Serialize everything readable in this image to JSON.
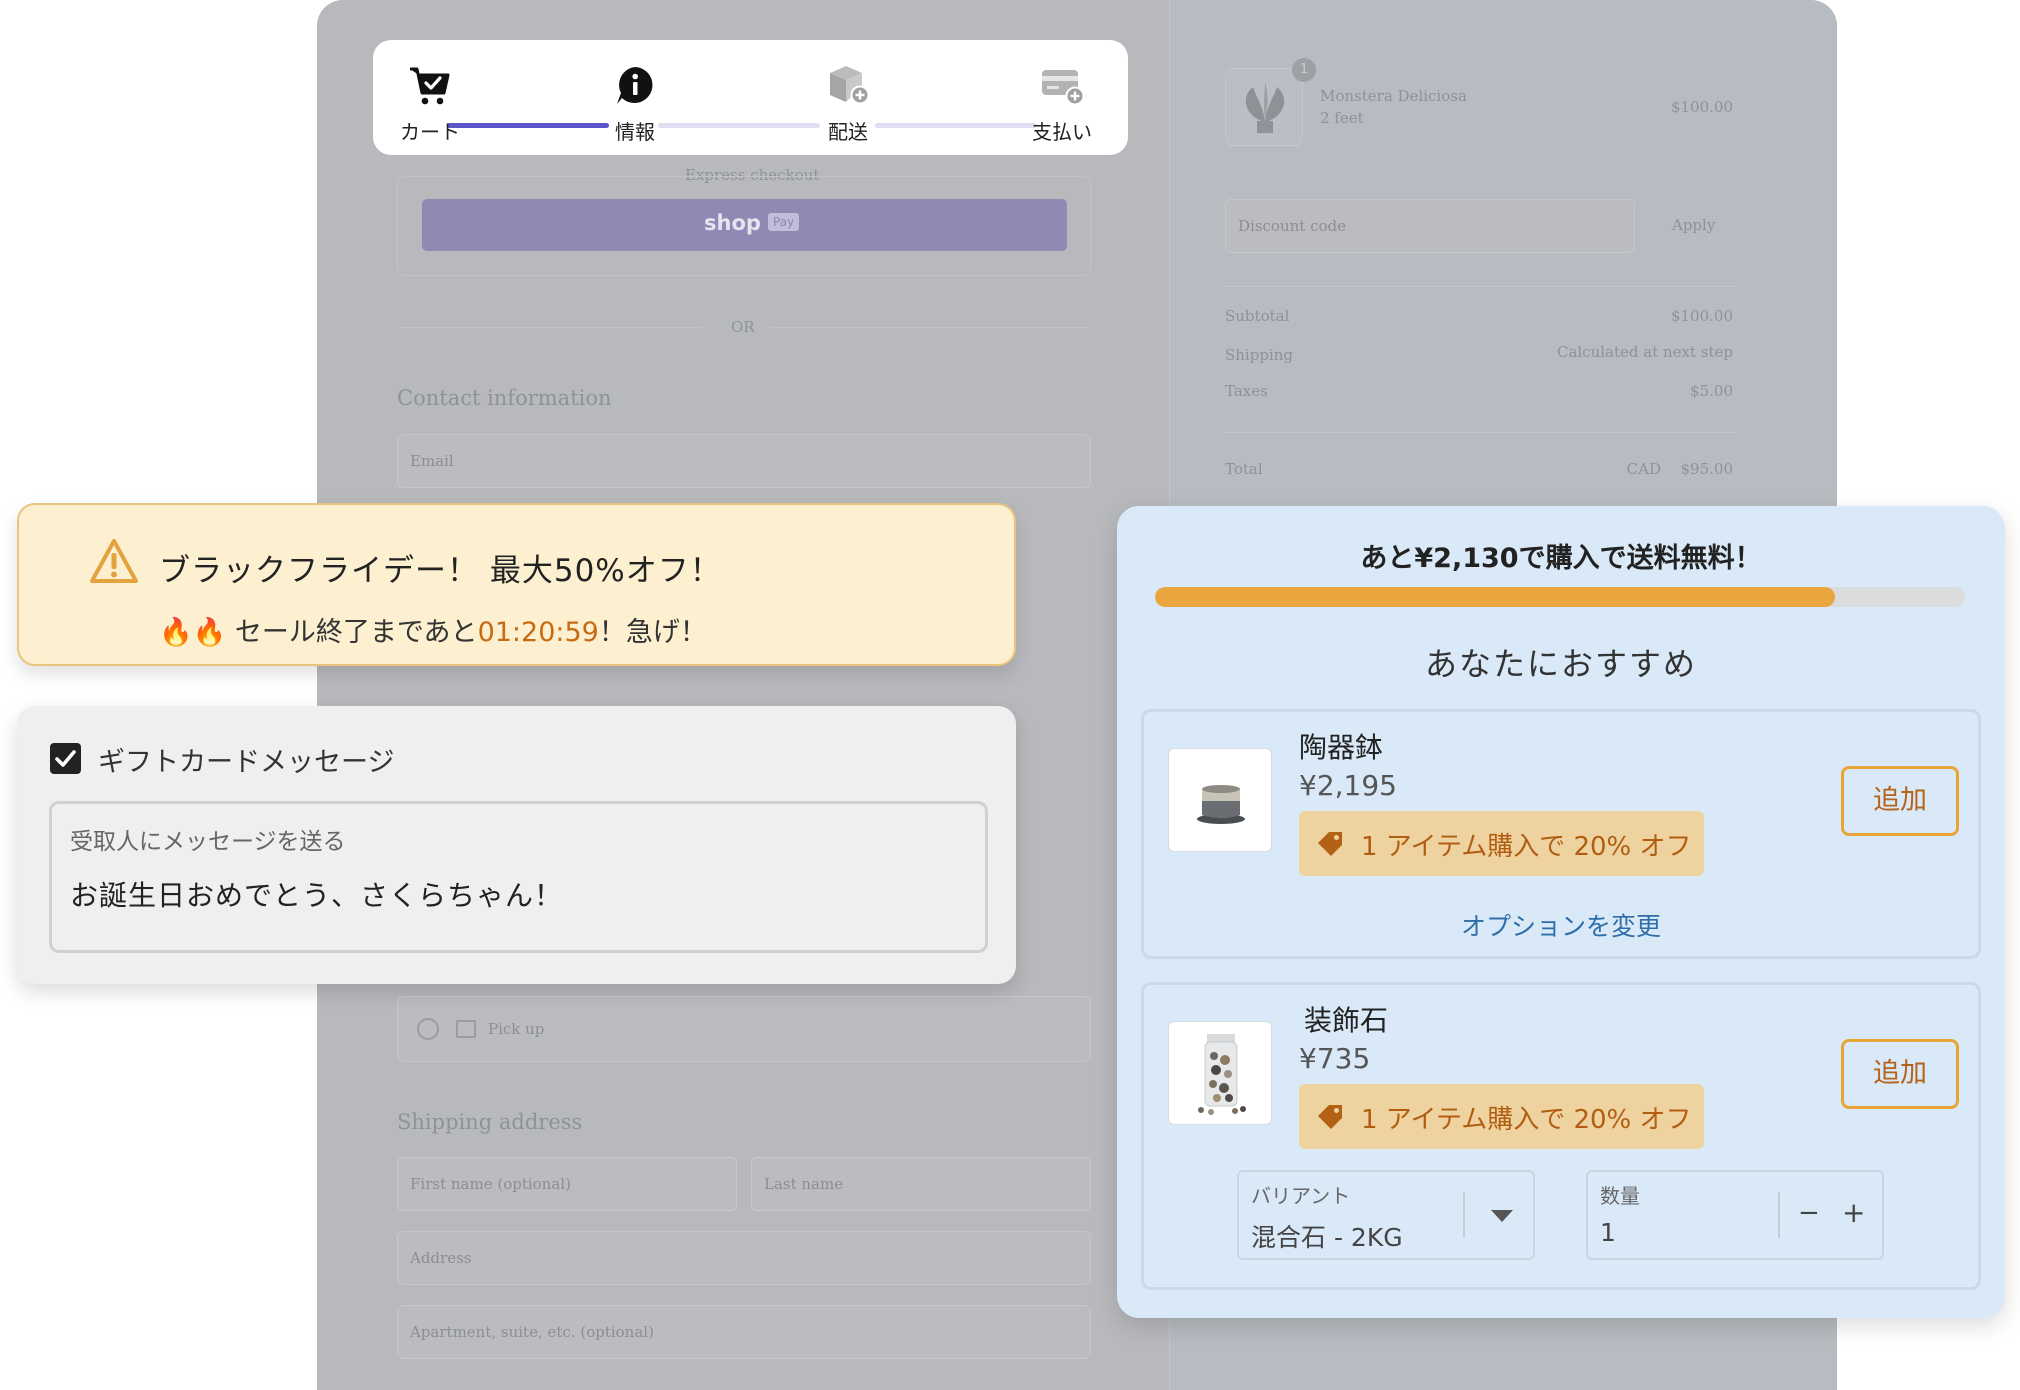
{
  "checkout": {
    "express_checkout": "Express checkout",
    "shop_pay": "shop",
    "shop_pay_badge": "Pay",
    "or": "OR",
    "contact_title": "Contact information",
    "email_placeholder": "Email",
    "pickup_label": "Pick up",
    "shipping_title": "Shipping address",
    "first_name_placeholder": "First name (optional)",
    "last_name_placeholder": "Last name",
    "address_placeholder": "Address",
    "apartment_placeholder": "Apartment, suite, etc. (optional)"
  },
  "summary": {
    "item_name": "Monstera Deliciosa",
    "item_variant": "2 feet",
    "item_qty": "1",
    "item_price": "$100.00",
    "discount_placeholder": "Discount code",
    "apply_label": "Apply",
    "subtotal_label": "Subtotal",
    "subtotal_value": "$100.00",
    "shipping_label": "Shipping",
    "shipping_value": "Calculated at next step",
    "taxes_label": "Taxes",
    "taxes_value": "$5.00",
    "total_label": "Total",
    "total_currency": "CAD",
    "total_value": "$95.00"
  },
  "stepper": {
    "steps": [
      {
        "label": "カート",
        "icon": "cart-icon"
      },
      {
        "label": "情報",
        "icon": "info-icon"
      },
      {
        "label": "配送",
        "icon": "box-icon"
      },
      {
        "label": "支払い",
        "icon": "card-icon"
      }
    ],
    "colors": {
      "active": "#5a55c9",
      "inactive": "#e1dff3"
    }
  },
  "promo": {
    "icon": "warning-icon",
    "title": "ブラックフライデー！ 最大50%オフ！",
    "sub_prefix": "🔥🔥 セール終了まであと",
    "timer": "01:20:59",
    "sub_suffix": "！急げ！"
  },
  "gift": {
    "checked": true,
    "title": "ギフトカードメッセージ",
    "placeholder": "受取人にメッセージを送る",
    "message": "お誕生日おめでとう、さくらちゃん！"
  },
  "upsell": {
    "shipping_message": "あと¥2,130で購入で送料無料！",
    "shipping_progress": 0.84,
    "title": "あなたにおすすめ",
    "products": [
      {
        "name": "陶器鉢",
        "price": "¥2,195",
        "discount": "1 アイテム購入で 20% オフ",
        "add_label": "追加",
        "option_link": "オプションを変更"
      },
      {
        "name": "装飾石",
        "price": "¥735",
        "discount": "1 アイテム購入で 20% オフ",
        "add_label": "追加",
        "variant_label": "バリアント",
        "variant_value": "混合石 - 2KG",
        "qty_label": "数量",
        "qty_value": "1",
        "minus": "−",
        "plus": "+"
      }
    ],
    "colors": {
      "accent": "#eaa63e",
      "panel": "#d9e9f8",
      "link": "#2f6ea8"
    }
  }
}
